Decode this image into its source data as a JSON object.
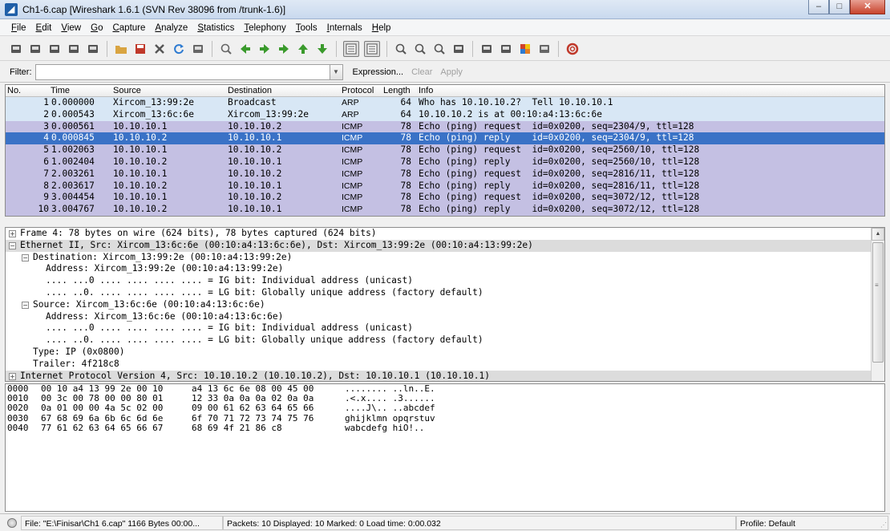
{
  "window": {
    "file_name": "Ch1-6.cap",
    "title": "Ch1-6.cap   [Wireshark 1.6.1  (SVN Rev 38096 from /trunk-1.6)]",
    "controls": {
      "minimize": "–",
      "maximize": "□",
      "close": "✕"
    }
  },
  "menu": [
    "File",
    "Edit",
    "View",
    "Go",
    "Capture",
    "Analyze",
    "Statistics",
    "Telephony",
    "Tools",
    "Internals",
    "Help"
  ],
  "toolbar": {
    "icons": [
      "interface-list-icon",
      "capture-options-icon",
      "start-capture-icon",
      "stop-capture-icon",
      "restart-capture-icon",
      "open-file-icon",
      "save-file-icon",
      "close-file-icon",
      "reload-icon",
      "print-icon",
      "find-packet-icon",
      "go-back-icon",
      "go-forward-icon",
      "go-to-packet-icon",
      "go-first-icon",
      "go-last-icon",
      "colorize-icon",
      "auto-scroll-icon",
      "zoom-in-icon",
      "zoom-out-icon",
      "normal-size-icon",
      "resize-columns-icon",
      "capture-filters-icon",
      "display-filters-icon",
      "coloring-rules-icon",
      "preferences-icon",
      "help-icon"
    ]
  },
  "filter": {
    "label": "Filter:",
    "value": "",
    "expression": "Expression...",
    "clear": "Clear",
    "apply": "Apply"
  },
  "packet_list": {
    "columns": [
      "No.",
      "Time",
      "Source",
      "Destination",
      "Protocol",
      "Length",
      "Info"
    ],
    "selected_index": 3,
    "rows": [
      {
        "no": "1",
        "time": "0.000000",
        "source": "Xircom_13:99:2e",
        "destination": "Broadcast",
        "protocol": "ARP",
        "length": "64",
        "info": "Who has 10.10.10.2?  Tell 10.10.10.1"
      },
      {
        "no": "2",
        "time": "0.000543",
        "source": "Xircom_13:6c:6e",
        "destination": "Xircom_13:99:2e",
        "protocol": "ARP",
        "length": "64",
        "info": "10.10.10.2 is at 00:10:a4:13:6c:6e"
      },
      {
        "no": "3",
        "time": "0.000561",
        "source": "10.10.10.1",
        "destination": "10.10.10.2",
        "protocol": "ICMP",
        "length": "78",
        "info": "Echo (ping) request  id=0x0200, seq=2304/9, ttl=128"
      },
      {
        "no": "4",
        "time": "0.000845",
        "source": "10.10.10.2",
        "destination": "10.10.10.1",
        "protocol": "ICMP",
        "length": "78",
        "info": "Echo (ping) reply    id=0x0200, seq=2304/9, ttl=128"
      },
      {
        "no": "5",
        "time": "1.002063",
        "source": "10.10.10.1",
        "destination": "10.10.10.2",
        "protocol": "ICMP",
        "length": "78",
        "info": "Echo (ping) request  id=0x0200, seq=2560/10, ttl=128"
      },
      {
        "no": "6",
        "time": "1.002404",
        "source": "10.10.10.2",
        "destination": "10.10.10.1",
        "protocol": "ICMP",
        "length": "78",
        "info": "Echo (ping) reply    id=0x0200, seq=2560/10, ttl=128"
      },
      {
        "no": "7",
        "time": "2.003261",
        "source": "10.10.10.1",
        "destination": "10.10.10.2",
        "protocol": "ICMP",
        "length": "78",
        "info": "Echo (ping) request  id=0x0200, seq=2816/11, ttl=128"
      },
      {
        "no": "8",
        "time": "2.003617",
        "source": "10.10.10.2",
        "destination": "10.10.10.1",
        "protocol": "ICMP",
        "length": "78",
        "info": "Echo (ping) reply    id=0x0200, seq=2816/11, ttl=128"
      },
      {
        "no": "9",
        "time": "3.004454",
        "source": "10.10.10.1",
        "destination": "10.10.10.2",
        "protocol": "ICMP",
        "length": "78",
        "info": "Echo (ping) request  id=0x0200, seq=3072/12, ttl=128"
      },
      {
        "no": "10",
        "time": "3.004767",
        "source": "10.10.10.2",
        "destination": "10.10.10.1",
        "protocol": "ICMP",
        "length": "78",
        "info": "Echo (ping) reply    id=0x0200, seq=3072/12, ttl=128"
      }
    ]
  },
  "details": {
    "lines": [
      {
        "text": "Frame 4: 78 bytes on wire (624 bits), 78 bytes captured (624 bits)",
        "level": 0,
        "expander": "+",
        "highlight": false
      },
      {
        "text": "Ethernet II, Src: Xircom_13:6c:6e (00:10:a4:13:6c:6e), Dst: Xircom_13:99:2e (00:10:a4:13:99:2e)",
        "level": 0,
        "expander": "−",
        "highlight": true
      },
      {
        "text": "Destination: Xircom_13:99:2e (00:10:a4:13:99:2e)",
        "level": 1,
        "expander": "−",
        "highlight": false
      },
      {
        "text": "Address: Xircom_13:99:2e (00:10:a4:13:99:2e)",
        "level": 2,
        "expander": "",
        "highlight": false
      },
      {
        "text": ".... ...0 .... .... .... .... = IG bit: Individual address (unicast)",
        "level": 2,
        "expander": "",
        "highlight": false
      },
      {
        "text": ".... ..0. .... .... .... .... = LG bit: Globally unique address (factory default)",
        "level": 2,
        "expander": "",
        "highlight": false
      },
      {
        "text": "Source: Xircom_13:6c:6e (00:10:a4:13:6c:6e)",
        "level": 1,
        "expander": "−",
        "highlight": false
      },
      {
        "text": "Address: Xircom_13:6c:6e (00:10:a4:13:6c:6e)",
        "level": 2,
        "expander": "",
        "highlight": false
      },
      {
        "text": ".... ...0 .... .... .... .... = IG bit: Individual address (unicast)",
        "level": 2,
        "expander": "",
        "highlight": false
      },
      {
        "text": ".... ..0. .... .... .... .... = LG bit: Globally unique address (factory default)",
        "level": 2,
        "expander": "",
        "highlight": false
      },
      {
        "text": "Type: IP (0x0800)",
        "level": 1,
        "expander": "",
        "highlight": false
      },
      {
        "text": "Trailer: 4f218c8",
        "level": 1,
        "expander": "",
        "highlight": false
      },
      {
        "text": "Internet Protocol Version 4, Src: 10.10.10.2 (10.10.10.2), Dst: 10.10.10.1 (10.10.10.1)",
        "level": 0,
        "expander": "+",
        "highlight": true
      }
    ]
  },
  "bytes": {
    "rows": [
      {
        "offset": "0000",
        "hex1": "00 10 a4 13 99 2e 00 10",
        "hex2": "a4 13 6c 6e 08 00 45 00",
        "ascii": "........ ..ln..E."
      },
      {
        "offset": "0010",
        "hex1": "00 3c 00 78 00 00 80 01",
        "hex2": "12 33 0a 0a 0a 02 0a 0a",
        "ascii": ".<.x.... .3......"
      },
      {
        "offset": "0020",
        "hex1": "0a 01 00 00 4a 5c 02 00",
        "hex2": "09 00 61 62 63 64 65 66",
        "ascii": "....J\\.. ..abcdef"
      },
      {
        "offset": "0030",
        "hex1": "67 68 69 6a 6b 6c 6d 6e",
        "hex2": "6f 70 71 72 73 74 75 76",
        "ascii": "ghijklmn opqrstuv"
      },
      {
        "offset": "0040",
        "hex1": "77 61 62 63 64 65 66 67",
        "hex2": "68 69 4f 21 86 c8",
        "ascii": "wabcdefg hiO!.."
      }
    ]
  },
  "status": {
    "file": "File: \"E:\\Finisar\\Ch1 6.cap\" 1166 Bytes 00:00...",
    "packets": "Packets: 10 Displayed: 10 Marked: 0 Load time: 0:00.032",
    "profile": "Profile: Default"
  },
  "colors": {
    "arp_row": "#d8e7f5",
    "icmp_row": "#c4c0e3",
    "selected_row": "#3a72c6"
  }
}
